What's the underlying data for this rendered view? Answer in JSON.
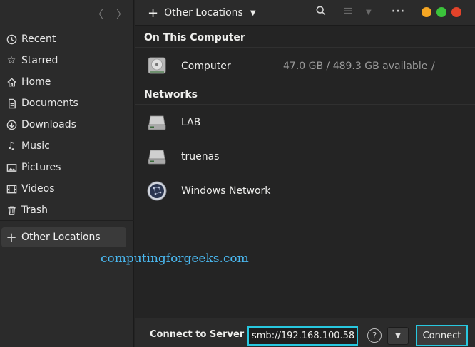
{
  "sidebar": {
    "items": [
      {
        "label": "Recent",
        "icon": "clock-icon"
      },
      {
        "label": "Starred",
        "icon": "star-icon"
      },
      {
        "label": "Home",
        "icon": "home-icon"
      },
      {
        "label": "Documents",
        "icon": "document-icon"
      },
      {
        "label": "Downloads",
        "icon": "download-icon"
      },
      {
        "label": "Music",
        "icon": "music-icon"
      },
      {
        "label": "Pictures",
        "icon": "picture-icon"
      },
      {
        "label": "Videos",
        "icon": "video-icon"
      },
      {
        "label": "Trash",
        "icon": "trash-icon"
      }
    ],
    "other_locations": {
      "label": "Other Locations",
      "icon": "plus-icon"
    }
  },
  "header": {
    "location_label": "Other Locations"
  },
  "main": {
    "on_this_computer": {
      "title": "On This Computer",
      "items": [
        {
          "label": "Computer",
          "info": "47.0 GB / 489.3 GB available",
          "path": "/",
          "icon": "drive-icon"
        }
      ]
    },
    "networks": {
      "title": "Networks",
      "items": [
        {
          "label": "LAB",
          "icon": "network-server-icon"
        },
        {
          "label": "truenas",
          "icon": "network-server-icon"
        },
        {
          "label": "Windows Network",
          "icon": "windows-network-icon"
        }
      ]
    }
  },
  "watermark": "computingforgeeks.com",
  "connect_bar": {
    "label": "Connect to Server",
    "server_value": "smb://192.168.100.58",
    "connect_label": "Connect"
  },
  "colors": {
    "highlight": "#28c8e0",
    "watermark": "#4ab8f0",
    "minimize": "#f5a623",
    "maximize": "#3bc33b",
    "close": "#e2432a"
  }
}
